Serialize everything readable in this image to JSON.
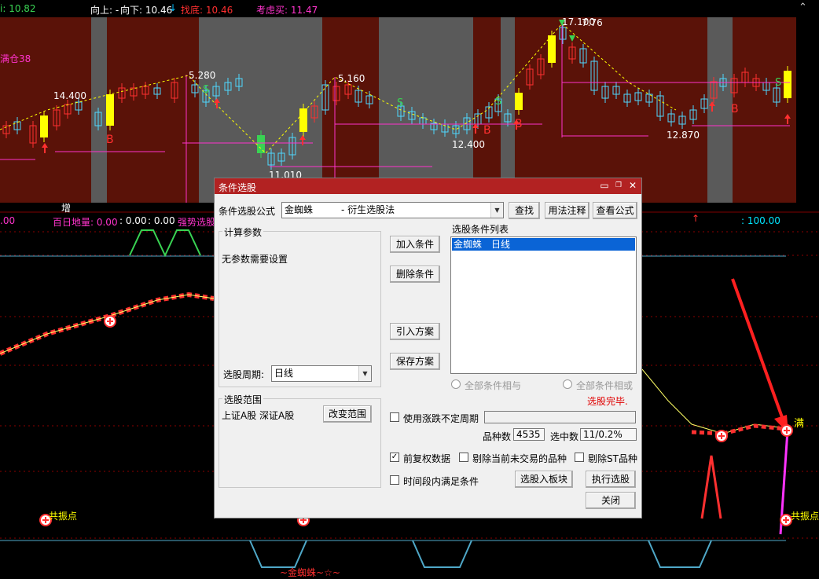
{
  "chart": {
    "top_labels": [
      {
        "text": "i: 10.82",
        "color": "#39d353"
      },
      {
        "text": "向上: -",
        "color": "#ffffff"
      },
      {
        "text": "向下: 10.46",
        "color": "#ffffff"
      },
      {
        "text": "↓",
        "color": "#00bfff"
      },
      {
        "text": "找底: 10.46",
        "color": "#ff3030"
      },
      {
        "text": "考虑买: 11.47",
        "color": "#ff33cc"
      }
    ],
    "side_label": "满仓38",
    "price_labels": [
      "14.400",
      "5.280",
      "5.160",
      "12.400",
      "12.870",
      "11.010",
      "17.100",
      "7.76"
    ],
    "ind_labels": [
      {
        "text": ".00",
        "color": "#ff33cc"
      },
      {
        "text": "百日地量: 0.00",
        "color": "#ff33cc"
      },
      {
        "text": ": 0.00",
        "color": "#ffffff"
      },
      {
        "text": ": 0.00",
        "color": "#ffffff"
      },
      {
        "text": "强势选股",
        "color": "#ff33cc"
      },
      {
        "text": "↑",
        "color": "#ff3030"
      },
      {
        "text": ": 100.00",
        "color": "#00e5ff"
      }
    ],
    "zeng_label": "增",
    "b_label": "B",
    "s_label": "S",
    "man_label": "满",
    "resonance_label": "共振点",
    "bottom_title": "~金蜘蛛~☆~",
    "colors": {
      "up": "#ff3030",
      "down": "#4fd8ff",
      "bg_band": "#5a1208",
      "gray_band": "#5a5a5a",
      "yellow": "#ffff00",
      "magenta": "#ff33cc"
    }
  },
  "dialog": {
    "title": "条件选股",
    "formula_label": "条件选股公式",
    "formula_value": "金蜘蛛　　　- 衍生选股法",
    "btn_find": "查找",
    "btn_usage": "用法注释",
    "btn_view": "查看公式",
    "params_group": "计算参数",
    "no_params": "无参数需要设置",
    "period_label": "选股周期:",
    "period_value": "日线",
    "scope_group": "选股范围",
    "scope_value": "上证A股 深证A股",
    "btn_change_scope": "改变范围",
    "btn_add": "加入条件",
    "btn_delete": "删除条件",
    "btn_import": "引入方案",
    "btn_save": "保存方案",
    "list_label": "选股条件列表",
    "list_items": [
      "金蜘蛛　日线"
    ],
    "radio_and": "全部条件相与",
    "radio_or": "全部条件相或",
    "status": "选股完毕.",
    "use_change_period": "使用涨跌不定周期",
    "count_label": "品种数",
    "count_value": "4535",
    "selected_label": "选中数",
    "selected_value": "11/0.2%",
    "pre_adjust": "前复权数据",
    "exclude_untraded": "剔除当前未交易的品种",
    "exclude_st": "剔除ST品种",
    "time_range": "时间段内满足条件",
    "btn_to_block": "选股入板块",
    "btn_execute": "执行选股",
    "btn_close": "关闭"
  }
}
